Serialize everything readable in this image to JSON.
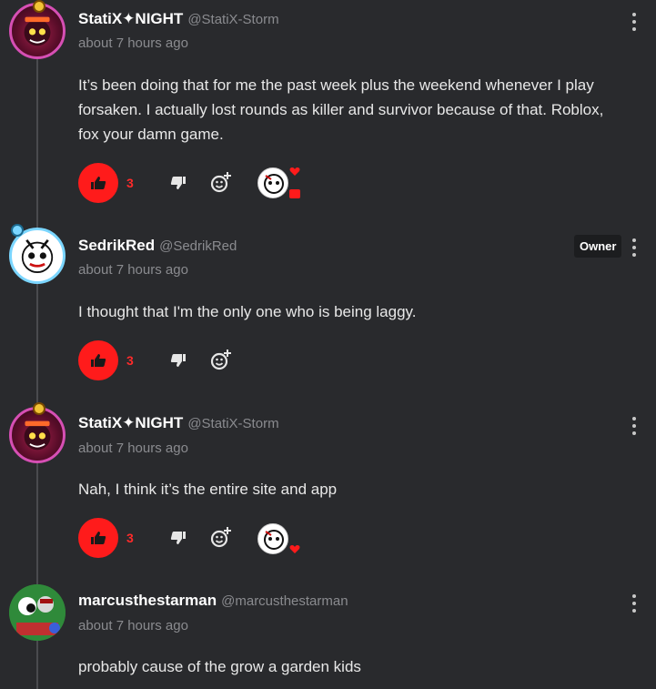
{
  "comments": [
    {
      "username": "StatiX✦NIGHT",
      "handle": "@StatiX-Storm",
      "time": "about 7 hours ago",
      "text": "It’s been doing that for me the past week plus the weekend whenever I play forsaken. I actually lost rounds as killer and survivor because of that. Roblox, fox your damn game.",
      "likes": "3"
    },
    {
      "username": "SedrikRed",
      "handle": "@SedrikRed",
      "badge": "Owner",
      "time": "about 7 hours ago",
      "text": "I thought that I'm the only one who is being laggy.",
      "likes": "3"
    },
    {
      "username": "StatiX✦NIGHT",
      "handle": "@StatiX-Storm",
      "time": "about 7 hours ago",
      "text": "Nah, I think it’s the entire site and app",
      "likes": "3"
    },
    {
      "username": "marcusthestarman",
      "handle": "@marcusthestarman",
      "time": "about 7 hours ago",
      "text": "probably cause of the grow a garden kids"
    }
  ],
  "icons": {
    "like": "thumbs-up-icon",
    "dislike": "thumbs-down-icon",
    "react": "add-reaction-icon",
    "menu": "kebab-menu-icon",
    "heart": "heart-icon"
  },
  "colors": {
    "background": "#292a2d",
    "like_active": "#ff1b1b",
    "handle": "#8a8b8f"
  }
}
